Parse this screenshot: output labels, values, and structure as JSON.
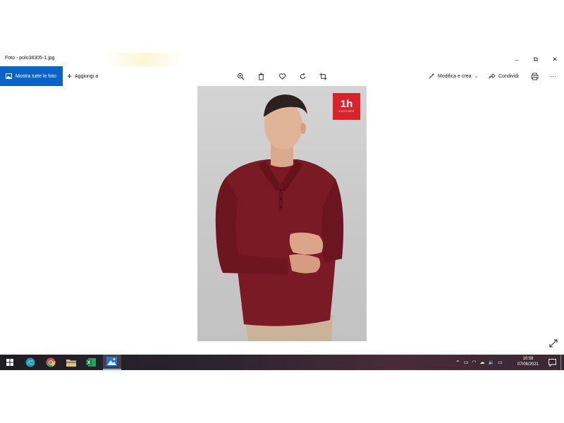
{
  "window": {
    "title": "Foto - polo38305-1.jpg",
    "controls": {
      "minimize": "–",
      "restore": "⧉",
      "close": "✕"
    }
  },
  "toolbar": {
    "show_all_label": "Mostra tutte le foto",
    "add_to_label": "Aggiungi a",
    "center_tools": [
      "zoom-icon",
      "trash-icon",
      "heart-icon",
      "rotate-icon",
      "crop-icon"
    ],
    "edit_create_label": "Modifica e crea",
    "share_label": "Condividi",
    "more_label": "···"
  },
  "photo": {
    "logo_main": "1h",
    "logo_sub": "CLOTHES",
    "colors": {
      "shirt": "#7a1a24",
      "trousers": "#c9b49a",
      "logo": "#d8232a",
      "background": "#c9c9c9"
    }
  },
  "taskbar": {
    "apps": [
      "edge-icon",
      "chrome-icon",
      "file-explorer-icon",
      "excel-icon",
      "photos-icon"
    ],
    "time": "10:58",
    "date": "07/06/2021"
  },
  "colors": {
    "accent": "#0a63c9"
  }
}
